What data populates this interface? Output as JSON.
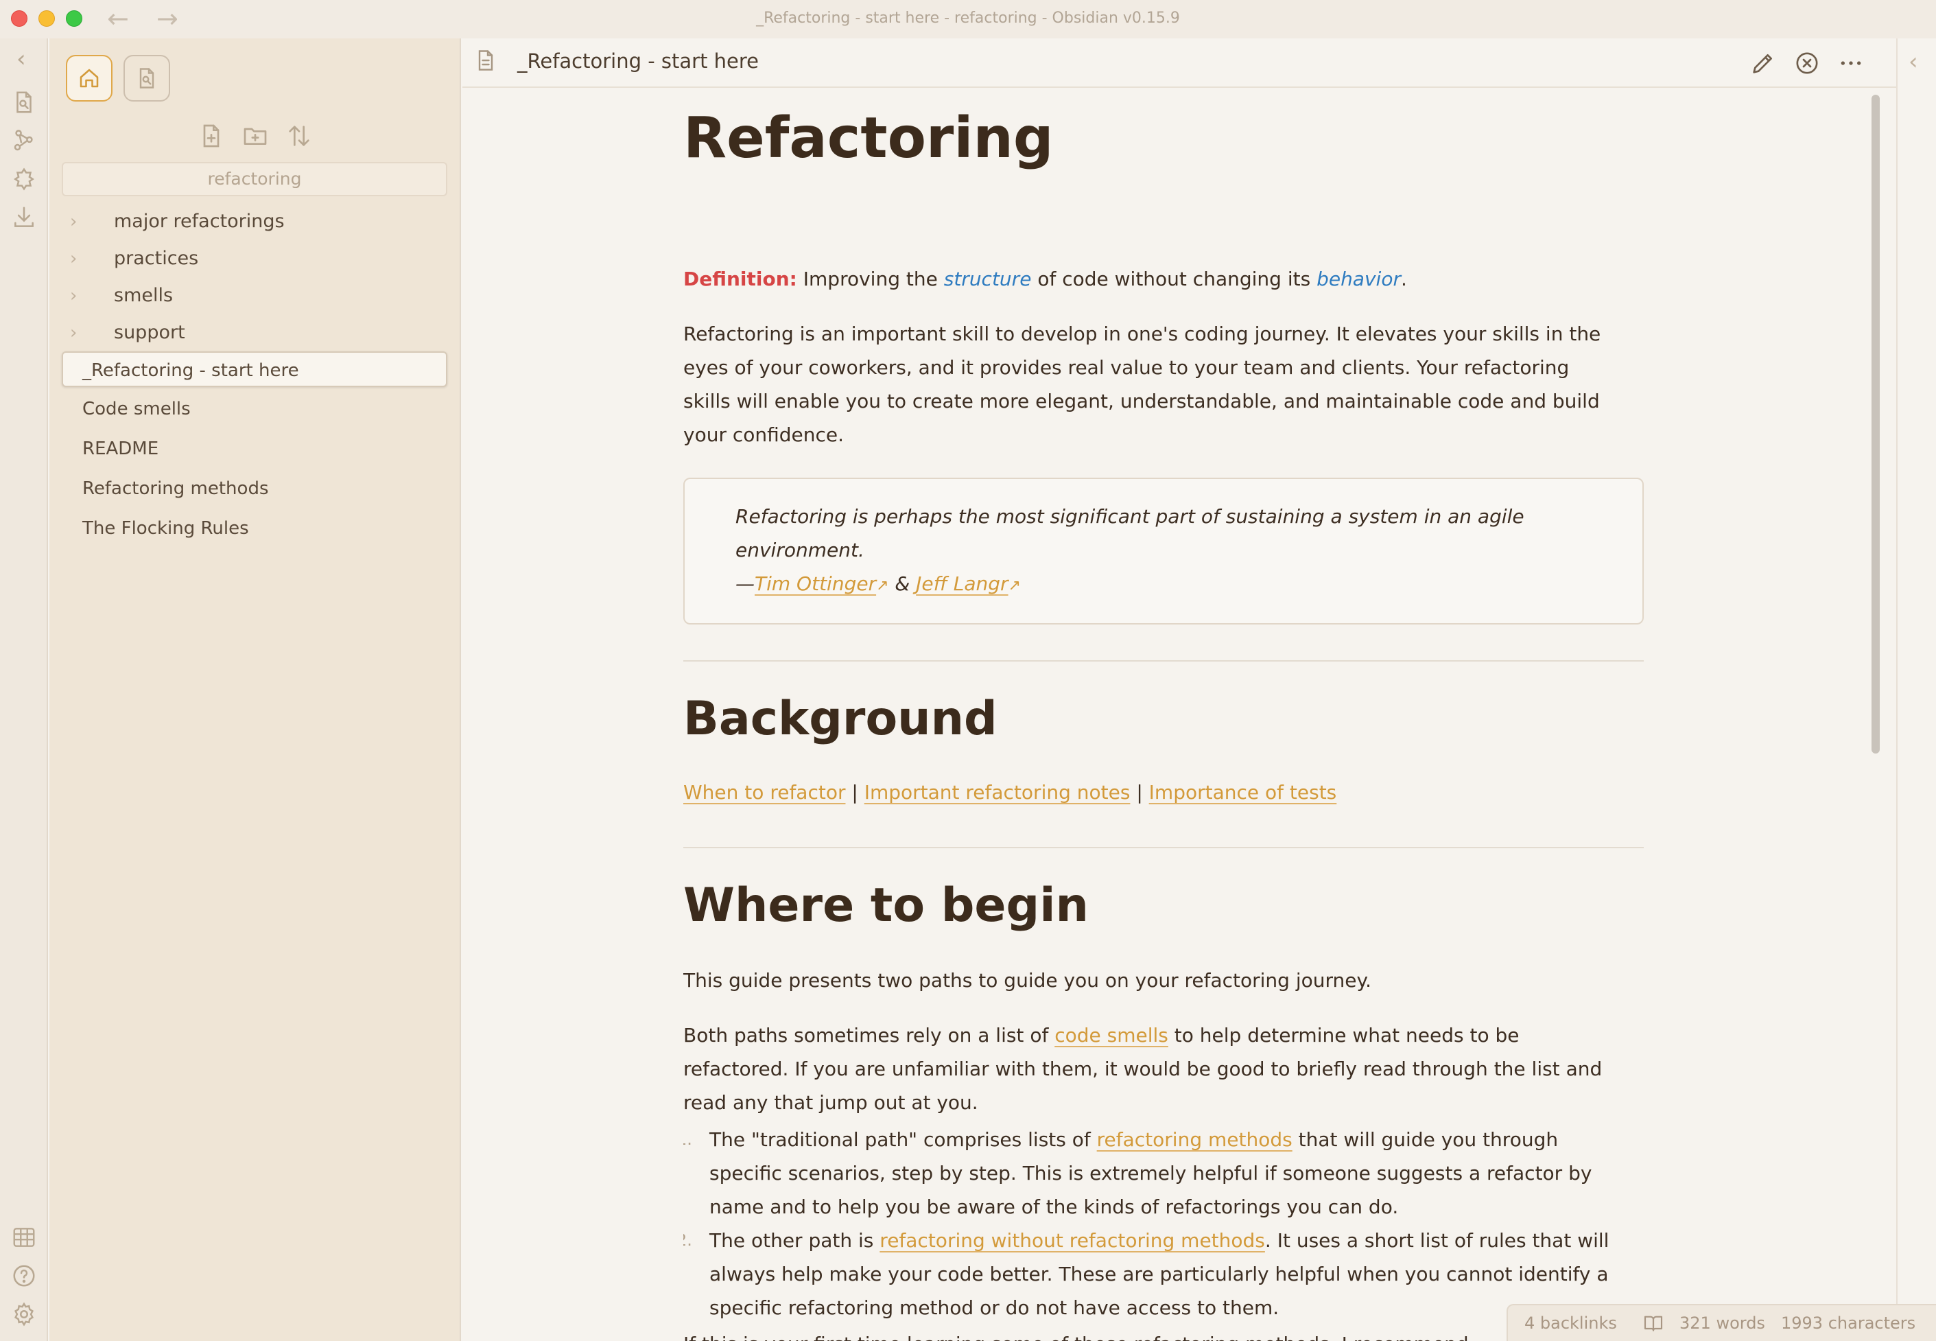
{
  "window": {
    "title": "_Refactoring - start here - refactoring - Obsidian v0.15.9",
    "back_glyph": "←",
    "forward_glyph": "→"
  },
  "ribbon": {
    "collapse_glyph": "‹",
    "icons": [
      "open-quick-switcher-icon",
      "graph-view-icon",
      "plugin-icon",
      "import-icon",
      "canvas-grid-icon",
      "help-icon",
      "settings-icon"
    ]
  },
  "sidebar": {
    "tabs": [
      "files-tab-icon",
      "search-tab-icon"
    ],
    "actions": [
      "new-note-icon",
      "new-folder-icon",
      "sort-icon"
    ],
    "vault_name": "refactoring",
    "folders": [
      {
        "label": "major refactorings",
        "chevron": "›"
      },
      {
        "label": "practices",
        "chevron": "›"
      },
      {
        "label": "smells",
        "chevron": "›"
      },
      {
        "label": "support",
        "chevron": "›"
      }
    ],
    "files": [
      {
        "label": "_Refactoring - start here"
      },
      {
        "label": "Code smells"
      },
      {
        "label": "README"
      },
      {
        "label": "Refactoring methods"
      },
      {
        "label": "The Flocking Rules"
      }
    ]
  },
  "view": {
    "title": "_Refactoring - start here",
    "actions": [
      "edit-pencil-icon",
      "close-circle-icon",
      "more-options-icon"
    ],
    "right_collapse_glyph": "‹",
    "fold_glyph": "⌄"
  },
  "note": {
    "h1_refactoring": "Refactoring",
    "definition_label": "Definition:",
    "definition_pre": " Improving the ",
    "definition_structure": "structure",
    "definition_mid": " of code without changing its ",
    "definition_behavior": "behavior",
    "definition_end": ".",
    "intro_lines": [
      "Refactoring is an important skill to develop in one's coding journey. It elevates your skills in the",
      "eyes of your coworkers, and it provides real value to your team and clients. Your refactoring",
      "skills will enable you to create more elegant, understandable, and maintainable code and build",
      "your confidence."
    ],
    "quote_lines": [
      "Refactoring is perhaps the most significant part of sustaining a system in an agile",
      "environment."
    ],
    "quote_dash": "—",
    "quote_author1": "Tim Ottinger",
    "quote_amp": " & ",
    "quote_author2": "Jeff Langr",
    "ext_glyph": "↗",
    "h1_background": "Background",
    "bg_link1": "When to refactor",
    "bg_link2": "Important refactoring notes",
    "bg_link3": "Importance of tests",
    "bg_sep": " | ",
    "h1_begin": "Where to begin",
    "begin_p1": "This guide presents two paths to guide you on your refactoring journey.",
    "begin_p2_pre": "Both paths sometimes rely on a list of ",
    "begin_p2_link": "code smells",
    "begin_p2_post": " to help determine what needs to be",
    "begin_p2_l2": "refactored. If you are unfamiliar with them, it would be good to briefly read through the list and",
    "begin_p2_l3": "read any that jump out at you.",
    "list": [
      {
        "num": "1.",
        "pre": "The \"traditional path\" comprises lists of ",
        "link": "refactoring methods",
        "post": " that will guide you through",
        "l2": "specific scenarios, step by step. This is extremely helpful if someone suggests a refactor by",
        "l3": "name and to help you be aware of the kinds of refactorings you can do."
      },
      {
        "num": "2.",
        "pre": "The other path is ",
        "link": "refactoring without refactoring methods",
        "post": ". It uses a short list of rules that will",
        "l2": "always help make your code better. These are particularly helpful when you cannot identify a",
        "l3": "specific refactoring method or do not have access to them."
      }
    ],
    "cutoff_line": "If this is your first time learning some of these refactoring methods, I recommend"
  },
  "status": {
    "backlinks": "4 backlinks",
    "words": "321 words",
    "characters": "1993 characters"
  },
  "colors": {
    "accent": "#d39a3a",
    "definition_red": "#d64545",
    "italic_blue": "#2f7cc0",
    "heading": "#3c2b1c"
  }
}
